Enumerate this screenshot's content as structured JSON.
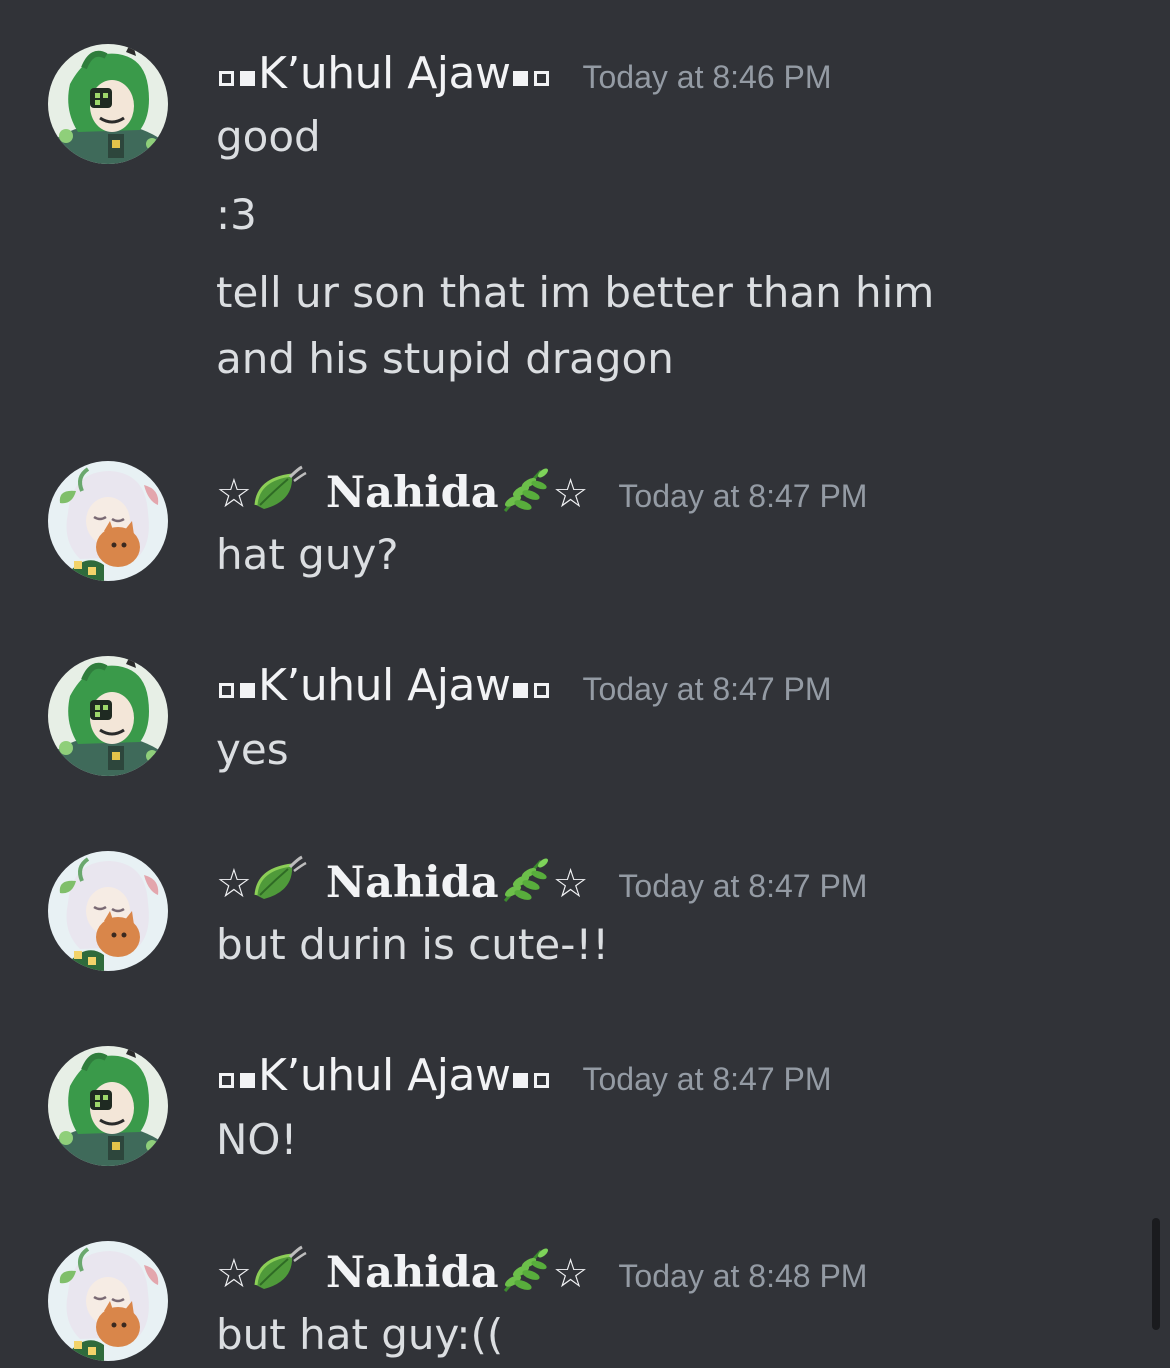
{
  "users": {
    "kuhul": {
      "name": "K’uhul Ajaw",
      "avatar_icon": "green-haired-character-avatar-icon"
    },
    "nahida": {
      "name": "Nahida",
      "prefix_star": "☆",
      "suffix_star": "☆",
      "avatar_icon": "white-haired-character-avatar-icon"
    }
  },
  "messages": [
    {
      "author": "kuhul",
      "timestamp": "Today at 8:46 PM",
      "lines": [
        "good",
        ":3",
        "tell ur son that im better than him and his stupid dragon"
      ]
    },
    {
      "author": "nahida",
      "timestamp": "Today at 8:47 PM",
      "lines": [
        "hat guy?"
      ]
    },
    {
      "author": "kuhul",
      "timestamp": "Today at 8:47 PM",
      "lines": [
        "yes"
      ]
    },
    {
      "author": "nahida",
      "timestamp": "Today at 8:47 PM",
      "lines": [
        "but durin is cute-!!"
      ]
    },
    {
      "author": "kuhul",
      "timestamp": "Today at 8:47 PM",
      "lines": [
        "NO!"
      ]
    },
    {
      "author": "nahida",
      "timestamp": "Today at 8:48 PM",
      "lines": [
        "but hat guy:(("
      ]
    }
  ],
  "colors": {
    "background": "#313338",
    "username": "#f2f3f5",
    "message_text": "#dbdee1",
    "timestamp": "#949ba4",
    "scrollbar": "#1a1b1e"
  }
}
